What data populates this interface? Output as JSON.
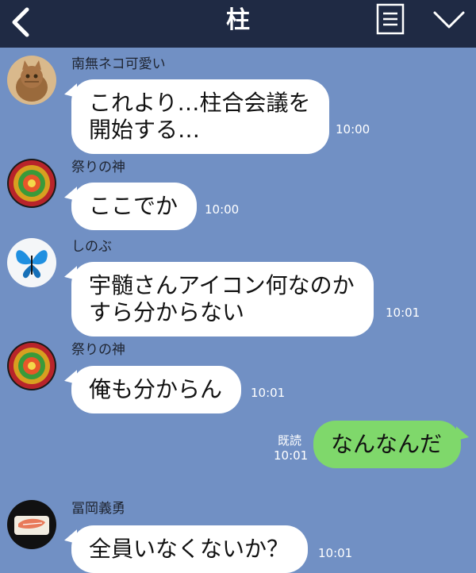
{
  "header": {
    "title": "柱",
    "back_icon": "chevron-left-icon",
    "menu_icon": "menu-icon",
    "down_icon": "chevron-down-icon"
  },
  "colors": {
    "header_bg": "#1f2a44",
    "chat_bg": "#7190c4",
    "incoming_bubble": "#ffffff",
    "outgoing_bubble": "#7fd86b"
  },
  "messages": [
    {
      "sender": "南無ネコ可愛い",
      "avatar": "cat-avatar",
      "text": "これより…柱合会議を\n開始する…",
      "time": "10:00"
    },
    {
      "sender": "祭りの神",
      "avatar": "festival-avatar",
      "text": "ここでか",
      "time": "10:00"
    },
    {
      "sender": "しのぶ",
      "avatar": "butterfly-avatar",
      "text": "宇髄さんアイコン何なのか\nすら分からない",
      "time": "10:01"
    },
    {
      "sender": "祭りの神",
      "avatar": "festival-avatar",
      "text": "俺も分からん",
      "time": "10:01"
    },
    {
      "outgoing": true,
      "read": "既読",
      "text": "なんなんだ",
      "time": "10:01"
    },
    {
      "sender": "冨岡義勇",
      "avatar": "salmon-avatar",
      "text": "全員いなくないか？",
      "time": "10:01"
    }
  ]
}
